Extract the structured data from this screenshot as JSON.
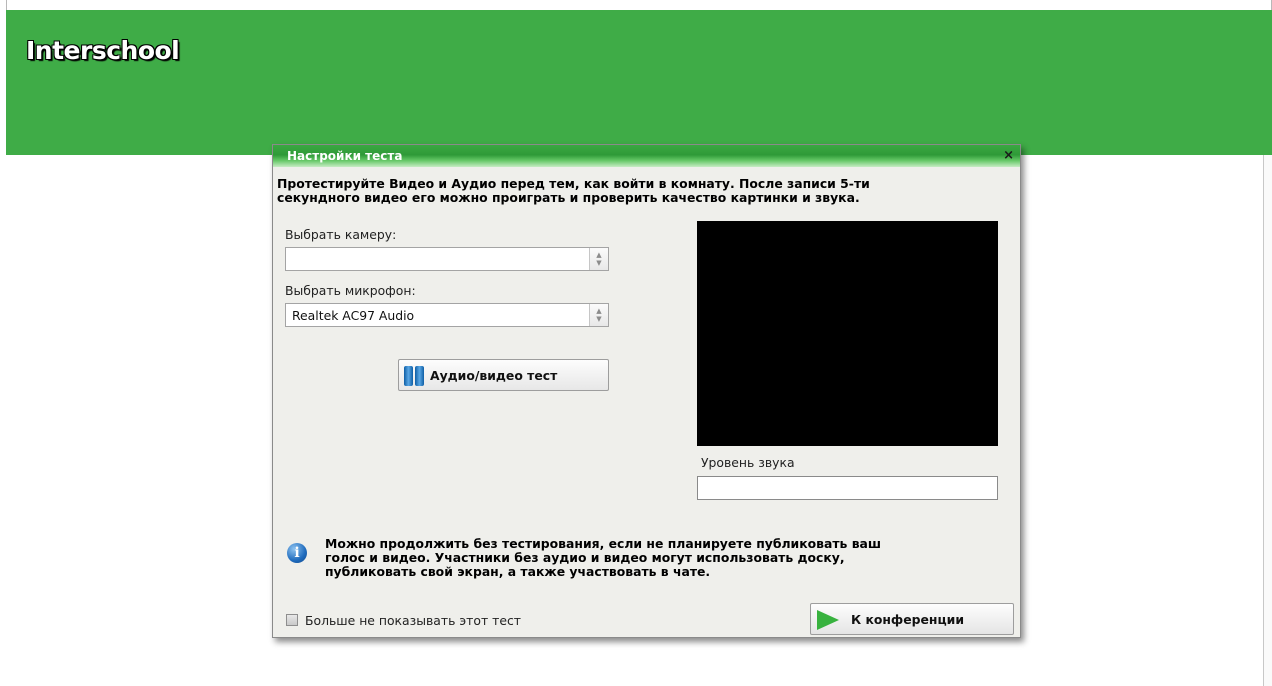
{
  "app": {
    "title": "Interschool",
    "header_color": "#3fac47"
  },
  "dialog": {
    "title": "Настройки теста",
    "close_glyph": "×",
    "intro_line1": "Протестируйте Видео и Аудио перед тем, как войти в комнату. После записи 5-ти",
    "intro_line2": "секундного видео его можно проиграть и проверить качество картинки и звука.",
    "camera": {
      "label": "Выбрать камеру:",
      "value": ""
    },
    "microphone": {
      "label": "Выбрать микрофон:",
      "value": "Realtek AC97 Audio"
    },
    "test_button": {
      "label": "Аудио/видео тест",
      "icon": "pause-bars-icon"
    },
    "sound_level_label": "Уровень звука",
    "info": {
      "icon": "info-icon",
      "line1": "Можно продолжить без тестирования, если не планируете публиковать ваш",
      "line2": "голос и видео. Участники без аудио и видео могут использовать доску,",
      "line3": "публиковать свой экран, а также участвовать в чате."
    },
    "dont_show_label": "Больше не показывать этот тест",
    "conference_button": {
      "label": "К конференции",
      "icon": "play-arrow-icon"
    }
  }
}
